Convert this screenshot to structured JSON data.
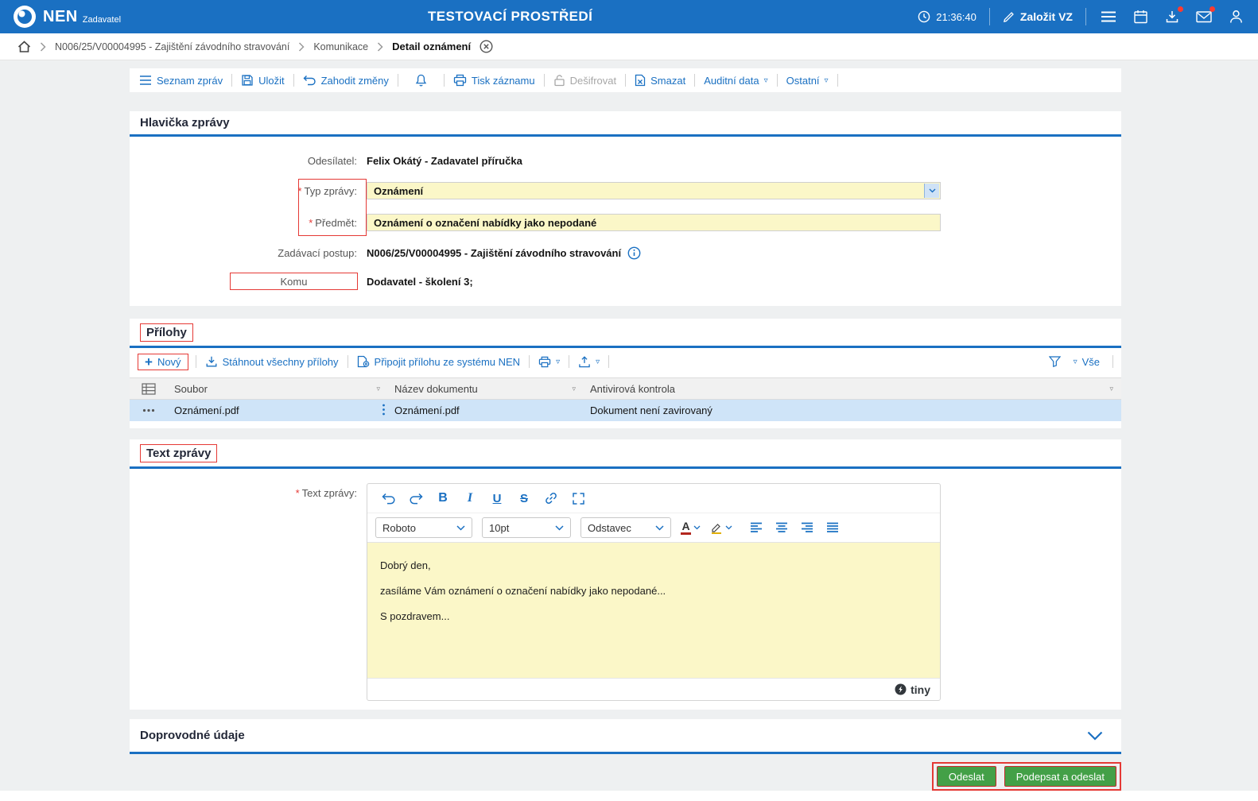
{
  "icons": {
    "caret_down": "▿",
    "bold": "B",
    "italic": "I",
    "underline": "U",
    "strikethrough": "S",
    "text_color": "A",
    "plus": "+"
  },
  "topbar": {
    "brand": "NEN",
    "brand_sub": "Zadavatel",
    "env_title": "TESTOVACÍ PROSTŘEDÍ",
    "time": "21:36:40",
    "create_vz": "Založit VZ"
  },
  "breadcrumb": {
    "items": [
      "N006/25/V00004995 - Zajištění závodního stravování",
      "Komunikace",
      "Detail oznámení"
    ]
  },
  "toolbar": {
    "message_list": "Seznam zpráv",
    "save": "Uložit",
    "discard": "Zahodit změny",
    "print": "Tisk záznamu",
    "decrypt": "Dešifrovat",
    "delete": "Smazat",
    "audit_data": "Auditní data",
    "other": "Ostatní"
  },
  "message_header": {
    "title": "Hlavička zprávy",
    "required_marker": "*",
    "sender_label": "Odesílatel:",
    "sender_value": "Felix Okátý - Zadavatel příručka",
    "type_label": "Typ zprávy:",
    "type_value": "Oznámení",
    "subject_label": "Předmět:",
    "subject_value": "Oznámení o označení nabídky jako nepodané",
    "procedure_label": "Zadávací postup:",
    "procedure_value": "N006/25/V00004995 - Zajištění závodního stravování",
    "to_label": "Komu",
    "to_value": "Dodavatel - školení 3;"
  },
  "attachments": {
    "title": "Přílohy",
    "new": "Nový",
    "download_all": "Stáhnout všechny přílohy",
    "attach_from_nen": "Připojit přílohu ze systému NEN",
    "filter_all": "Vše",
    "columns": [
      "Soubor",
      "Název dokumentu",
      "Antivirová kontrola"
    ],
    "rows": [
      {
        "file": "Oznámení.pdf",
        "document_name": "Oznámení.pdf",
        "antivirus": "Dokument není zavirovaný"
      }
    ]
  },
  "message_text": {
    "title": "Text zprávy",
    "required_marker": "*",
    "label": "Text zprávy:",
    "editor": {
      "font_name": "Roboto",
      "font_size": "10pt",
      "block_format": "Odstavec",
      "lines": [
        "Dobrý den,",
        "zasíláme Vám oznámení o označení nabídky jako nepodané...",
        "S pozdravem..."
      ],
      "brand": "tiny"
    }
  },
  "additional": {
    "title": "Doprovodné údaje"
  },
  "actions": {
    "send": "Odeslat",
    "sign_and_send": "Podepsat a odeslat"
  },
  "colors": {
    "header_blue": "#1a70c2",
    "accent_blue": "#1a70c2",
    "annotation_red": "#e53935",
    "input_yellow": "#fbf7c8",
    "selected_row_blue": "#cfe4f8",
    "button_green": "#43a047"
  }
}
